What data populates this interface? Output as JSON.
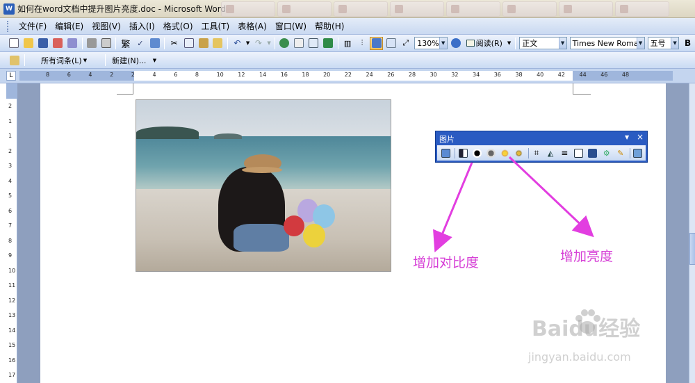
{
  "window": {
    "title": "如何在word文档中提升图片亮度.doc - Microsoft Word",
    "app_icon": "W"
  },
  "menu": {
    "items": [
      "文件(F)",
      "编辑(E)",
      "视图(V)",
      "插入(I)",
      "格式(O)",
      "工具(T)",
      "表格(A)",
      "窗口(W)",
      "帮助(H)"
    ]
  },
  "toolbar": {
    "zoom": "130%",
    "read_label": "阅读(R)",
    "style": "正文",
    "font": "Times New Roma",
    "font_size": "五号",
    "bold_label": "B"
  },
  "toolbar2": {
    "all_entries": "所有词条(L)",
    "new_entry": "新建(N)..."
  },
  "ruler": {
    "numbers": [
      "8",
      "6",
      "4",
      "2",
      "2",
      "4",
      "6",
      "8",
      "10",
      "12",
      "14",
      "16",
      "18",
      "20",
      "22",
      "24",
      "26",
      "28",
      "30",
      "32",
      "34",
      "36",
      "38",
      "40",
      "42",
      "44",
      "46",
      "48"
    ],
    "vertical_numbers": [
      "2",
      "1",
      "1",
      "2",
      "3",
      "4",
      "5",
      "6",
      "7",
      "8",
      "9",
      "10",
      "11",
      "12",
      "13",
      "14",
      "15",
      "16",
      "17"
    ]
  },
  "picture_toolbar": {
    "title": "图片",
    "close": "×",
    "dropdown": "▼"
  },
  "annotations": {
    "contrast": "增加对比度",
    "brightness": "增加亮度",
    "accent_color": "#d63fd6"
  },
  "watermark": {
    "brand": "Baidu经验",
    "url": "jingyan.baidu.com"
  },
  "colors": {
    "menubar": "#c9d9f1",
    "title_text": "#111111",
    "picture_toolbar": "#2a5bc2"
  }
}
